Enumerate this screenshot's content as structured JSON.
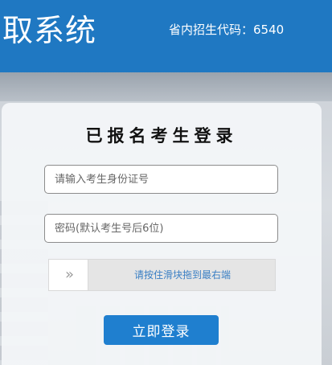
{
  "header": {
    "title": "取系统",
    "code_label": "省内招生代码：6540"
  },
  "login": {
    "title": "已报名考生登录",
    "id_placeholder": "请输入考生身份证号",
    "password_placeholder": "密码(默认考生号后6位)",
    "slider_handle": "»",
    "slider_text": "请按住滑块拖到最右端",
    "submit_label": "立即登录"
  },
  "colors": {
    "header_bg": "#1f78c2",
    "button_bg": "#1f7fcf",
    "slider_text": "#3a7fc4"
  }
}
